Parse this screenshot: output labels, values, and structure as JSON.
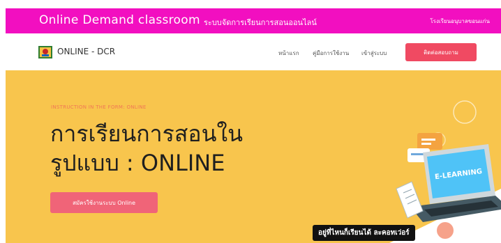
{
  "topbar": {
    "title": "Online Demand classroom",
    "subtitle": "ระบบจัดการเรียนการสอนออนไลน์",
    "link": "โรงเรียนอนุบาลขอนแก่น"
  },
  "navbar": {
    "brand": "ONLINE - DCR",
    "links": [
      "หน้าแรก",
      "คู่มือการใช้งาน",
      "เข้าสู่ระบบ"
    ],
    "cta": "ติดต่อสอบถาม"
  },
  "hero": {
    "eyebrow": "INSTRUCTION IN THE FORM: ONLINE",
    "headline_line1": "การเรียนการสอนใน",
    "headline_line2": "รูปแบบ : ONLINE",
    "button": "สมัครใช้งานระบบ Online",
    "laptop_label": "E-LEARNING",
    "banner": "อยู่ที่ไหนก็เรียนได้ ละคอทเว่อร์"
  },
  "colors": {
    "topbar": "#f20fc0",
    "hero_bg": "#f8c54d",
    "accent": "#f04a62"
  }
}
